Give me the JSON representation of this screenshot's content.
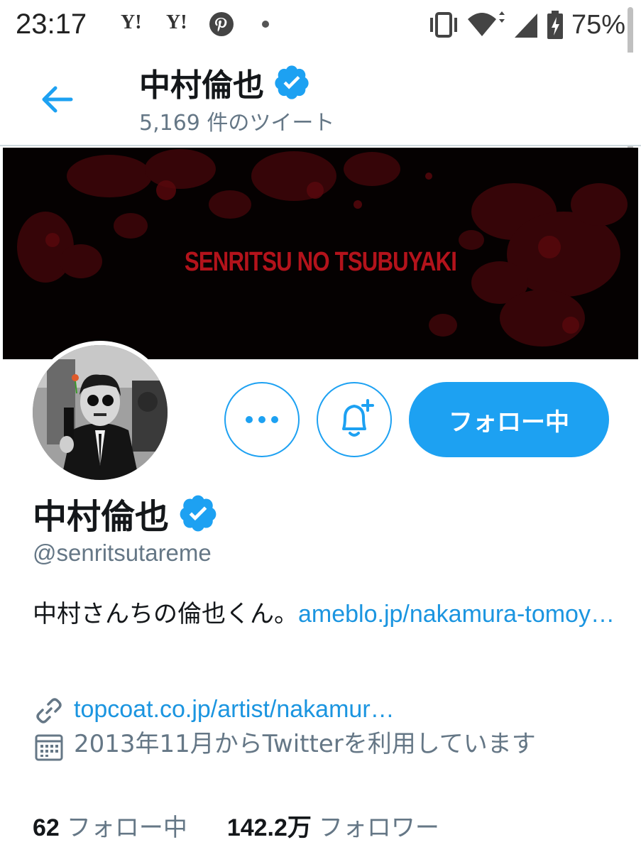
{
  "status_bar": {
    "time": "23:17",
    "notifications": [
      "Y!",
      "Y!"
    ],
    "battery": "75%"
  },
  "header": {
    "name": "中村倫也",
    "tweet_count": "5,169 件のツイート"
  },
  "banner": {
    "text": "SENRITSU NO TSUBUYAKI"
  },
  "actions": {
    "follow_label": "フォロー中"
  },
  "profile": {
    "name": "中村倫也",
    "handle": "@senritsutareme",
    "bio_text": "中村さんちの倫也くん。",
    "bio_link": "ameblo.jp/nakamura-tomoy…",
    "website": "topcoat.co.jp/artist/nakamur…",
    "joined": "2013年11月からTwitterを利用しています"
  },
  "stats": {
    "following_count": "62",
    "following_label": "フォロー中",
    "followers_count": "142.2万",
    "followers_label": "フォロワー"
  },
  "colors": {
    "accent": "#1da1f2",
    "link": "#1b95e0",
    "muted": "#657786",
    "banner_red": "#b3131b"
  }
}
